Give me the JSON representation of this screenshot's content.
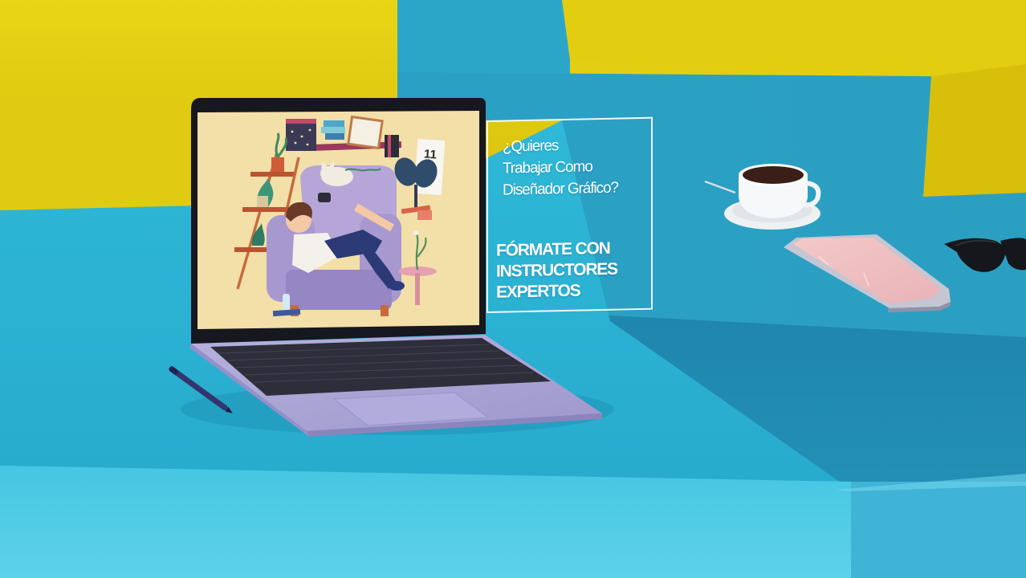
{
  "caption": {
    "question": "¿Quieres\nTrabajar Como\nDiseñador Gráfico?",
    "callout": "FÓRMATE CON\nINSTRUCTORES\nEXPERTOS"
  },
  "screen_illustration": {
    "calendar_day": "11"
  },
  "colors": {
    "wall_yellow": "#e4d012",
    "block_teal": "#28b6d6",
    "screen_background": "#f3dfa8",
    "laptop_silver": "#a9a3d4",
    "caption_white": "#ffffff"
  }
}
